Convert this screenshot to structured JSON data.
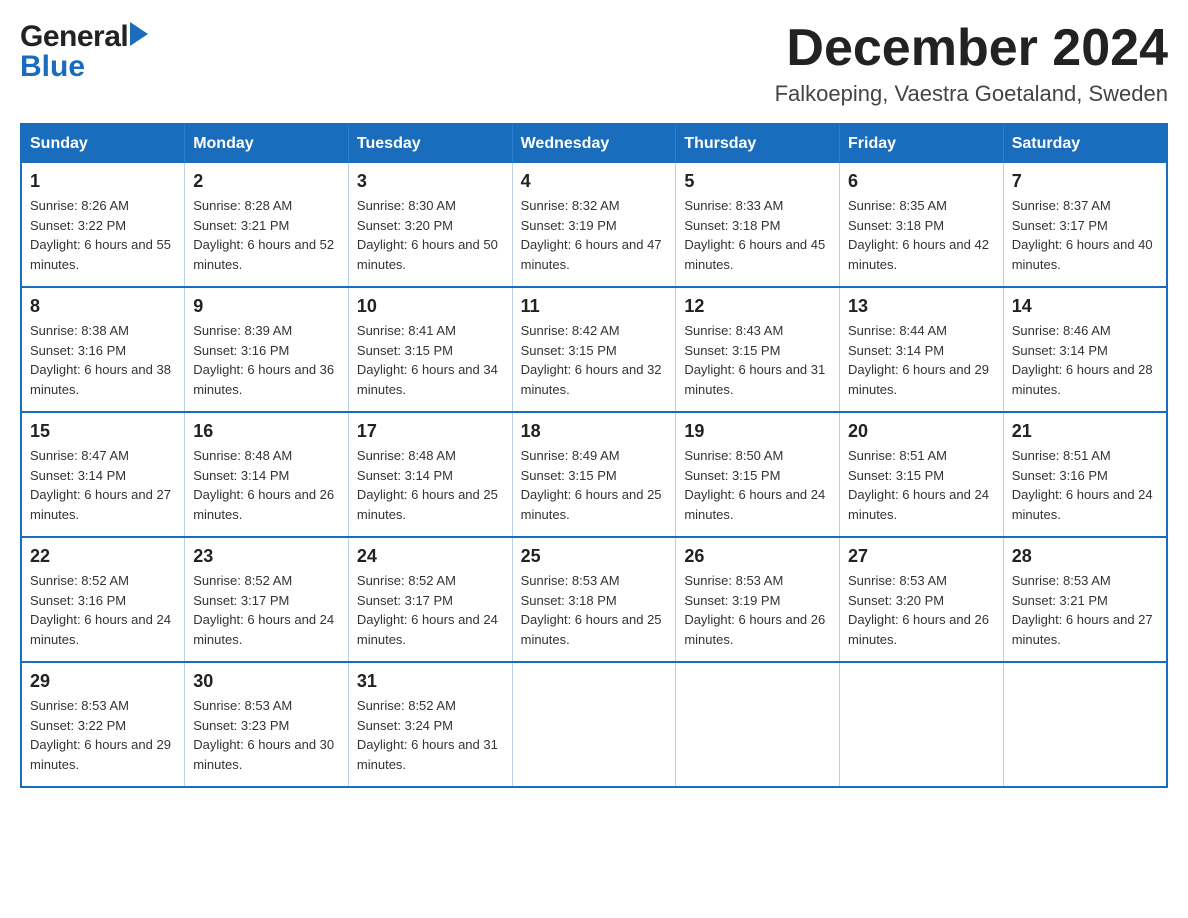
{
  "header": {
    "logo_general": "General",
    "logo_flag": "▶",
    "logo_blue": "Blue",
    "month_title": "December 2024",
    "location": "Falkoeping, Vaestra Goetaland, Sweden"
  },
  "weekdays": [
    "Sunday",
    "Monday",
    "Tuesday",
    "Wednesday",
    "Thursday",
    "Friday",
    "Saturday"
  ],
  "weeks": [
    [
      {
        "day": "1",
        "sunrise": "8:26 AM",
        "sunset": "3:22 PM",
        "daylight": "6 hours and 55 minutes."
      },
      {
        "day": "2",
        "sunrise": "8:28 AM",
        "sunset": "3:21 PM",
        "daylight": "6 hours and 52 minutes."
      },
      {
        "day": "3",
        "sunrise": "8:30 AM",
        "sunset": "3:20 PM",
        "daylight": "6 hours and 50 minutes."
      },
      {
        "day": "4",
        "sunrise": "8:32 AM",
        "sunset": "3:19 PM",
        "daylight": "6 hours and 47 minutes."
      },
      {
        "day": "5",
        "sunrise": "8:33 AM",
        "sunset": "3:18 PM",
        "daylight": "6 hours and 45 minutes."
      },
      {
        "day": "6",
        "sunrise": "8:35 AM",
        "sunset": "3:18 PM",
        "daylight": "6 hours and 42 minutes."
      },
      {
        "day": "7",
        "sunrise": "8:37 AM",
        "sunset": "3:17 PM",
        "daylight": "6 hours and 40 minutes."
      }
    ],
    [
      {
        "day": "8",
        "sunrise": "8:38 AM",
        "sunset": "3:16 PM",
        "daylight": "6 hours and 38 minutes."
      },
      {
        "day": "9",
        "sunrise": "8:39 AM",
        "sunset": "3:16 PM",
        "daylight": "6 hours and 36 minutes."
      },
      {
        "day": "10",
        "sunrise": "8:41 AM",
        "sunset": "3:15 PM",
        "daylight": "6 hours and 34 minutes."
      },
      {
        "day": "11",
        "sunrise": "8:42 AM",
        "sunset": "3:15 PM",
        "daylight": "6 hours and 32 minutes."
      },
      {
        "day": "12",
        "sunrise": "8:43 AM",
        "sunset": "3:15 PM",
        "daylight": "6 hours and 31 minutes."
      },
      {
        "day": "13",
        "sunrise": "8:44 AM",
        "sunset": "3:14 PM",
        "daylight": "6 hours and 29 minutes."
      },
      {
        "day": "14",
        "sunrise": "8:46 AM",
        "sunset": "3:14 PM",
        "daylight": "6 hours and 28 minutes."
      }
    ],
    [
      {
        "day": "15",
        "sunrise": "8:47 AM",
        "sunset": "3:14 PM",
        "daylight": "6 hours and 27 minutes."
      },
      {
        "day": "16",
        "sunrise": "8:48 AM",
        "sunset": "3:14 PM",
        "daylight": "6 hours and 26 minutes."
      },
      {
        "day": "17",
        "sunrise": "8:48 AM",
        "sunset": "3:14 PM",
        "daylight": "6 hours and 25 minutes."
      },
      {
        "day": "18",
        "sunrise": "8:49 AM",
        "sunset": "3:15 PM",
        "daylight": "6 hours and 25 minutes."
      },
      {
        "day": "19",
        "sunrise": "8:50 AM",
        "sunset": "3:15 PM",
        "daylight": "6 hours and 24 minutes."
      },
      {
        "day": "20",
        "sunrise": "8:51 AM",
        "sunset": "3:15 PM",
        "daylight": "6 hours and 24 minutes."
      },
      {
        "day": "21",
        "sunrise": "8:51 AM",
        "sunset": "3:16 PM",
        "daylight": "6 hours and 24 minutes."
      }
    ],
    [
      {
        "day": "22",
        "sunrise": "8:52 AM",
        "sunset": "3:16 PM",
        "daylight": "6 hours and 24 minutes."
      },
      {
        "day": "23",
        "sunrise": "8:52 AM",
        "sunset": "3:17 PM",
        "daylight": "6 hours and 24 minutes."
      },
      {
        "day": "24",
        "sunrise": "8:52 AM",
        "sunset": "3:17 PM",
        "daylight": "6 hours and 24 minutes."
      },
      {
        "day": "25",
        "sunrise": "8:53 AM",
        "sunset": "3:18 PM",
        "daylight": "6 hours and 25 minutes."
      },
      {
        "day": "26",
        "sunrise": "8:53 AM",
        "sunset": "3:19 PM",
        "daylight": "6 hours and 26 minutes."
      },
      {
        "day": "27",
        "sunrise": "8:53 AM",
        "sunset": "3:20 PM",
        "daylight": "6 hours and 26 minutes."
      },
      {
        "day": "28",
        "sunrise": "8:53 AM",
        "sunset": "3:21 PM",
        "daylight": "6 hours and 27 minutes."
      }
    ],
    [
      {
        "day": "29",
        "sunrise": "8:53 AM",
        "sunset": "3:22 PM",
        "daylight": "6 hours and 29 minutes."
      },
      {
        "day": "30",
        "sunrise": "8:53 AM",
        "sunset": "3:23 PM",
        "daylight": "6 hours and 30 minutes."
      },
      {
        "day": "31",
        "sunrise": "8:52 AM",
        "sunset": "3:24 PM",
        "daylight": "6 hours and 31 minutes."
      },
      null,
      null,
      null,
      null
    ]
  ]
}
